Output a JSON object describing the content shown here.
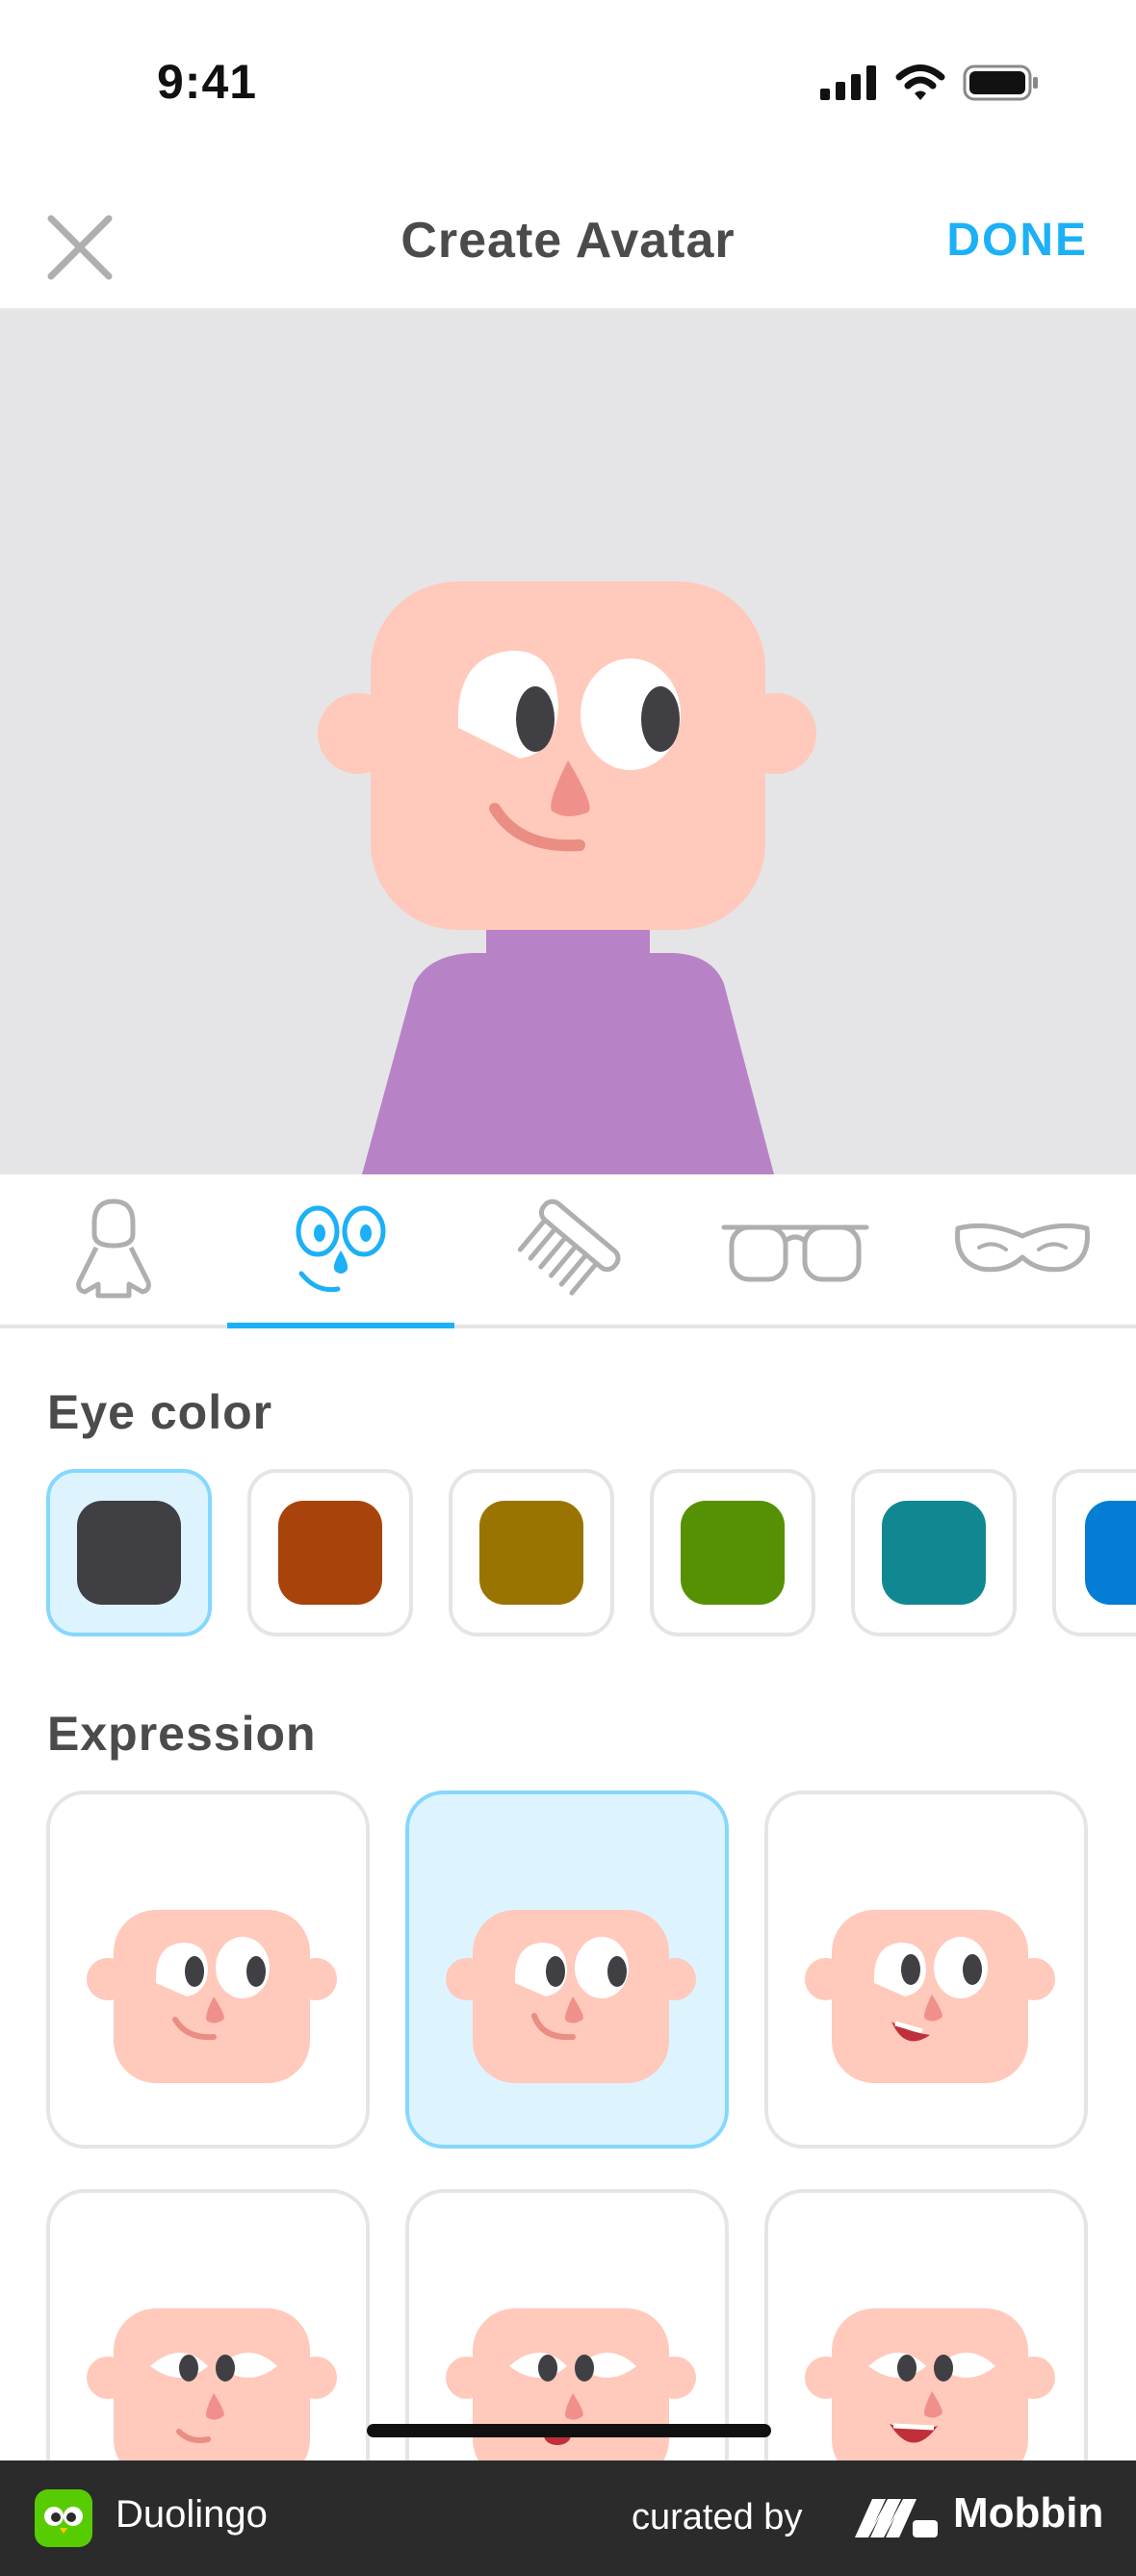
{
  "status_bar": {
    "time": "9:41"
  },
  "nav": {
    "title": "Create Avatar",
    "done_label": "DONE"
  },
  "tabs": [
    {
      "name": "body-icon",
      "active": false
    },
    {
      "name": "face-icon",
      "active": true
    },
    {
      "name": "comb-icon",
      "active": false
    },
    {
      "name": "glasses-icon",
      "active": false
    },
    {
      "name": "mustache-icon",
      "active": false
    }
  ],
  "eye_color": {
    "title": "Eye color",
    "swatches": [
      "#403f44",
      "#a8430c",
      "#9a7400",
      "#559102",
      "#118891",
      "#037ed4"
    ],
    "selected_index": 0
  },
  "expression": {
    "title": "Expression",
    "selected_index": 1
  },
  "avatar": {
    "skin": "#ffc9bb",
    "shirt": "#b883c6"
  },
  "footer": {
    "app_name": "Duolingo",
    "curated_by": "curated by",
    "brand": "Mobbin"
  }
}
